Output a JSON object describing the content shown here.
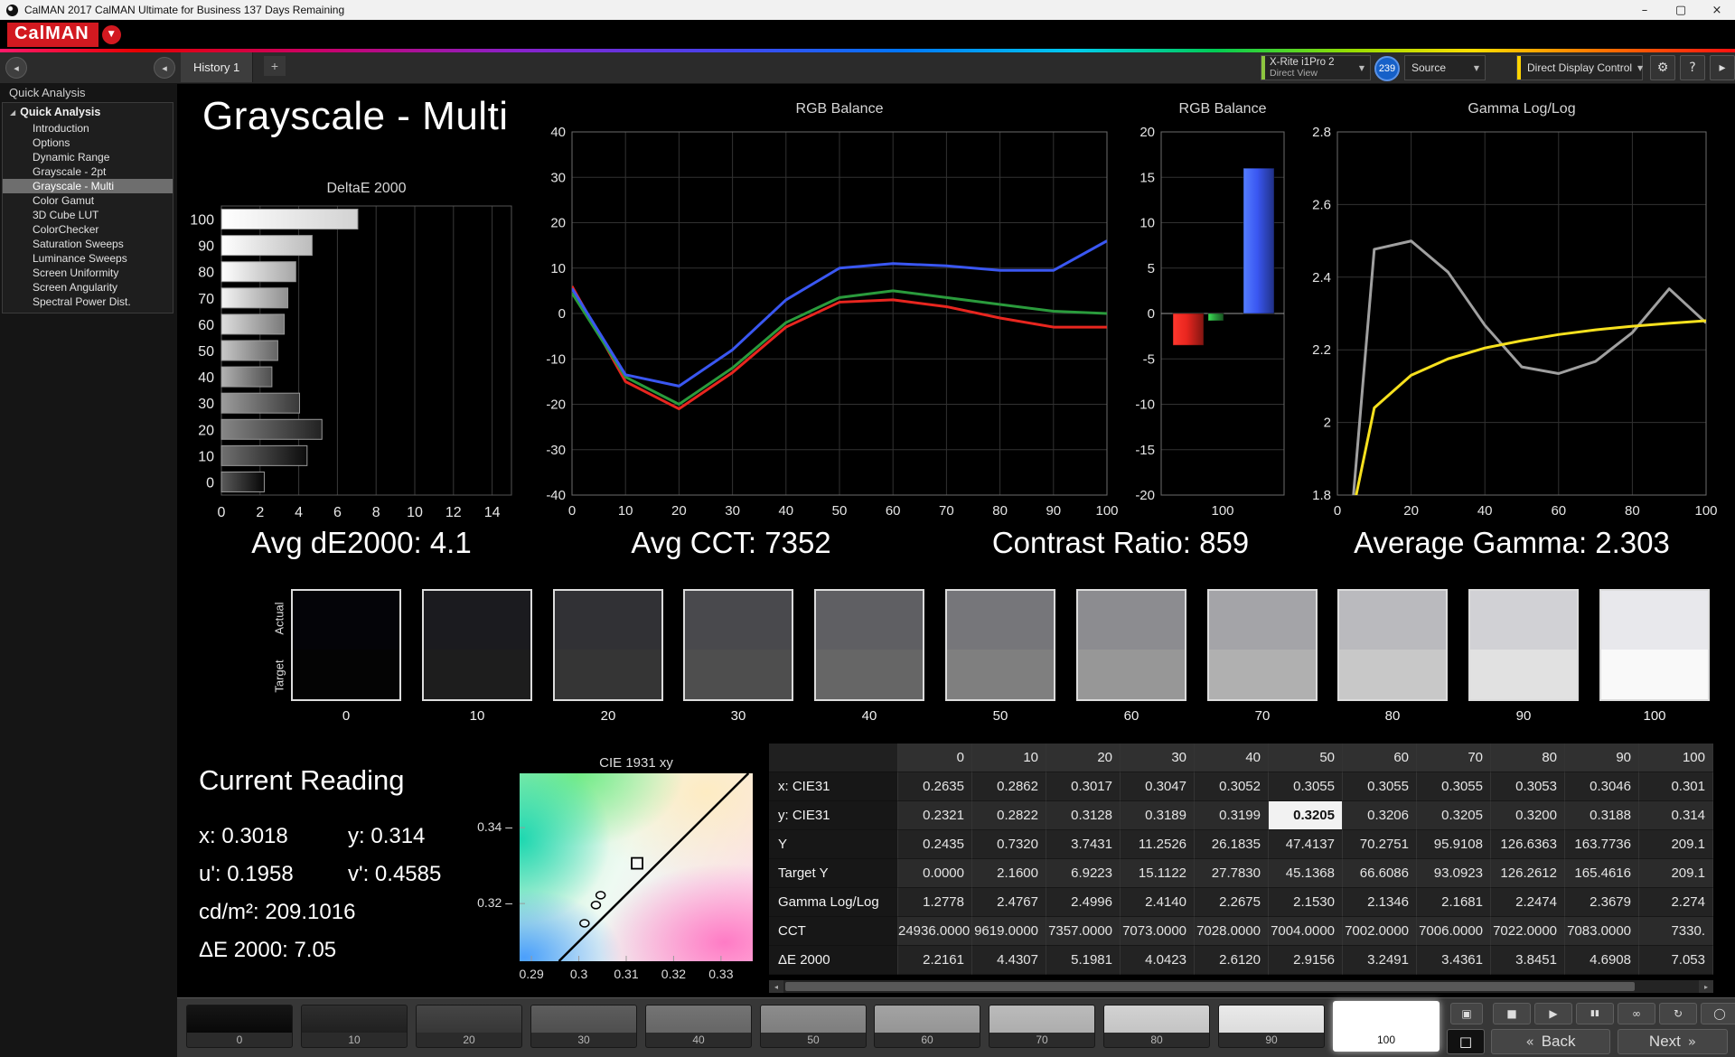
{
  "window": {
    "title": "CalMAN 2017 CalMAN Ultimate for Business 137 Days Remaining",
    "controls": [
      {
        "name": "minimize-button",
        "glyph": "–"
      },
      {
        "name": "maximize-button",
        "glyph": "▢"
      },
      {
        "name": "close-button",
        "glyph": "×"
      }
    ]
  },
  "brand": {
    "logo_text": "CalMAN",
    "dropdown_glyph": "▼",
    "accent": "#d21920"
  },
  "tabs": {
    "active": "History 1",
    "add_glyph": "+"
  },
  "toolbar": {
    "collapse_glyph": "◂",
    "chev_glyph": "▼",
    "meter": {
      "line1": "X-Rite i1Pro 2",
      "line2": "Direct View",
      "stripe": "#8dc63f"
    },
    "badge": "239",
    "source": {
      "label": "Source"
    },
    "display_control": {
      "label": "Direct Display Control",
      "stripe": "#ffd400"
    },
    "buttons": [
      {
        "name": "settings-button",
        "glyph": "⚙"
      },
      {
        "name": "help-button",
        "glyph": "?"
      },
      {
        "name": "advance-button",
        "glyph": "▸"
      }
    ]
  },
  "sidebar": {
    "panel_title": "Quick Analysis",
    "root": "Quick Analysis",
    "items": [
      "Introduction",
      "Options",
      "Dynamic Range",
      "Grayscale - 2pt",
      "Grayscale - Multi",
      "Color Gamut",
      "3D Cube LUT",
      "ColorChecker",
      "Saturation Sweeps",
      "Luminance Sweeps",
      "Screen Uniformity",
      "Screen Angularity",
      "Spectral Power Dist."
    ],
    "selected": "Grayscale - Multi"
  },
  "page": {
    "title": "Grayscale - Multi"
  },
  "stats": [
    "Avg dE2000: 4.1",
    "Avg CCT: 7352",
    "Contrast Ratio: 859",
    "Average Gamma: 2.303"
  ],
  "chart_data": [
    {
      "type": "bar",
      "orientation": "horizontal",
      "title": "DeltaE 2000",
      "categories": [
        "100",
        "90",
        "80",
        "70",
        "60",
        "50",
        "40",
        "30",
        "20",
        "10",
        "0"
      ],
      "values": [
        7.053,
        4.6908,
        3.8451,
        3.4361,
        3.2491,
        2.9156,
        2.612,
        4.0423,
        5.1981,
        4.4307,
        2.2161
      ],
      "xlim": [
        0,
        15
      ],
      "xticks": [
        0,
        2,
        4,
        6,
        8,
        10,
        12,
        14
      ],
      "grid": true
    },
    {
      "type": "line",
      "title": "RGB Balance",
      "x": [
        0,
        10,
        20,
        30,
        40,
        50,
        60,
        70,
        80,
        90,
        100
      ],
      "ylim": [
        -40,
        40
      ],
      "yticks": [
        -40,
        -30,
        -20,
        -10,
        0,
        10,
        20,
        30,
        40
      ],
      "xticks": [
        0,
        10,
        20,
        30,
        40,
        50,
        60,
        70,
        80,
        90,
        100
      ],
      "grid": true,
      "series": [
        {
          "name": "red-balance",
          "color": "#e8261f",
          "values": [
            6,
            -15,
            -21,
            -13,
            -3,
            2.5,
            3,
            1.5,
            -1,
            -3,
            -3
          ]
        },
        {
          "name": "green-balance",
          "color": "#2a9b3c",
          "values": [
            4.5,
            -14,
            -20,
            -12,
            -2,
            3.5,
            5,
            3.5,
            2,
            0.5,
            0
          ]
        },
        {
          "name": "blue-balance",
          "color": "#3a57f2",
          "values": [
            5.5,
            -13.5,
            -16,
            -8,
            3,
            10,
            11,
            10.5,
            9.5,
            9.5,
            16
          ]
        }
      ]
    },
    {
      "type": "bar",
      "title": "RGB Balance",
      "categories": [
        "100"
      ],
      "ylim": [
        -20,
        20
      ],
      "yticks": [
        -20,
        -15,
        -10,
        -5,
        0,
        5,
        10,
        15,
        20
      ],
      "grid": true,
      "series": [
        {
          "name": "red-error",
          "color": "#e8261f",
          "values": [
            -3.5
          ]
        },
        {
          "name": "green-error",
          "color": "#2a9b3c",
          "values": [
            -0.8
          ]
        },
        {
          "name": "blue-error",
          "color": "#3a57f2",
          "values": [
            16
          ]
        }
      ]
    },
    {
      "type": "line",
      "title": "Gamma Log/Log",
      "x": [
        0,
        10,
        20,
        30,
        40,
        50,
        60,
        70,
        80,
        90,
        100
      ],
      "ylim": [
        1.8,
        2.8
      ],
      "yticks": [
        1.8,
        2,
        2.2,
        2.4,
        2.6,
        2.8
      ],
      "xticks": [
        0,
        20,
        40,
        60,
        80,
        100
      ],
      "grid": true,
      "series": [
        {
          "name": "measured-gamma",
          "color": "#a0a0a0",
          "values": [
            1.2778,
            2.4767,
            2.4996,
            2.414,
            2.2675,
            2.153,
            2.1346,
            2.1681,
            2.2474,
            2.3679,
            2.274
          ]
        },
        {
          "name": "target-gamma",
          "color": "#f7e11e",
          "values": [
            1.55,
            2.04,
            2.13,
            2.175,
            2.205,
            2.225,
            2.242,
            2.255,
            2.265,
            2.273,
            2.28
          ]
        }
      ]
    },
    {
      "type": "scatter",
      "title": "CIE 1931 xy",
      "xlim": [
        0.2875,
        0.3367
      ],
      "ylim": [
        0.3048,
        0.3543
      ],
      "xticks": [
        0.29,
        0.3,
        0.31,
        0.32,
        0.33
      ],
      "yticks": [
        0.34,
        0.32
      ],
      "line": [
        [
          0.2958,
          0.3048
        ],
        [
          0.3358,
          0.3543
        ]
      ],
      "points": [
        {
          "shape": "square",
          "x": 0.3123,
          "y": 0.3306
        },
        {
          "shape": "circle",
          "x": 0.3046,
          "y": 0.3222
        },
        {
          "shape": "circle",
          "x": 0.3036,
          "y": 0.3196
        },
        {
          "shape": "circle",
          "x": 0.3012,
          "y": 0.3148
        }
      ]
    }
  ],
  "swatches": {
    "row_labels": [
      "Actual",
      "Target"
    ],
    "levels": [
      0,
      10,
      20,
      30,
      40,
      50,
      60,
      70,
      80,
      90,
      100
    ]
  },
  "current_reading": {
    "title": "Current Reading",
    "x_label": "x:",
    "x_value": "0.3018",
    "y_label": "y:",
    "y_value": "0.314",
    "u_label": "u':",
    "u_value": "0.1958",
    "v_label": "v':",
    "v_value": "0.4585",
    "lum_label": "cd/m²:",
    "lum_value": "209.1016",
    "de_label": "ΔE 2000:",
    "de_value": "7.05"
  },
  "table": {
    "columns": [
      "",
      "0",
      "10",
      "20",
      "30",
      "40",
      "50",
      "60",
      "70",
      "80",
      "90",
      "100"
    ],
    "rows": [
      {
        "label": "x: CIE31",
        "values": [
          "0.2635",
          "0.2862",
          "0.3017",
          "0.3047",
          "0.3052",
          "0.3055",
          "0.3055",
          "0.3055",
          "0.3053",
          "0.3046",
          "0.301"
        ]
      },
      {
        "label": "y: CIE31",
        "highlight_col": 5,
        "values": [
          "0.2321",
          "0.2822",
          "0.3128",
          "0.3189",
          "0.3199",
          "0.3205",
          "0.3206",
          "0.3205",
          "0.3200",
          "0.3188",
          "0.314"
        ]
      },
      {
        "label": "Y",
        "values": [
          "0.2435",
          "0.7320",
          "3.7431",
          "11.2526",
          "26.1835",
          "47.4137",
          "70.2751",
          "95.9108",
          "126.6363",
          "163.7736",
          "209.1"
        ]
      },
      {
        "label": "Target Y",
        "values": [
          "0.0000",
          "2.1600",
          "6.9223",
          "15.1122",
          "27.7830",
          "45.1368",
          "66.6086",
          "93.0923",
          "126.2612",
          "165.4616",
          "209.1"
        ]
      },
      {
        "label": "Gamma Log/Log",
        "values": [
          "1.2778",
          "2.4767",
          "2.4996",
          "2.4140",
          "2.2675",
          "2.1530",
          "2.1346",
          "2.1681",
          "2.2474",
          "2.3679",
          "2.274"
        ]
      },
      {
        "label": "CCT",
        "values": [
          "24936.0000",
          "9619.0000",
          "7357.0000",
          "7073.0000",
          "7028.0000",
          "7004.0000",
          "7002.0000",
          "7006.0000",
          "7022.0000",
          "7083.0000",
          "7330."
        ]
      },
      {
        "label": "ΔE 2000",
        "values": [
          "2.2161",
          "4.4307",
          "5.1981",
          "4.0423",
          "2.6120",
          "2.9156",
          "3.2491",
          "3.4361",
          "3.8451",
          "4.6908",
          "7.053"
        ]
      }
    ]
  },
  "bottom": {
    "patch_levels": [
      0,
      10,
      20,
      30,
      40,
      50,
      60,
      70,
      80,
      90,
      100
    ],
    "selected_level": 100,
    "eject_glyph": "▣",
    "pattern_glyph": "□",
    "transport": [
      {
        "name": "stop-button",
        "glyph": "■"
      },
      {
        "name": "play-button",
        "glyph": "▶"
      },
      {
        "name": "pause-button",
        "glyph": "▮▮"
      },
      {
        "name": "loop-button",
        "glyph": "∞"
      },
      {
        "name": "refresh-button",
        "glyph": "↻"
      },
      {
        "name": "record-button",
        "glyph": "◯"
      }
    ],
    "back_glyph": "«",
    "back_label": "Back",
    "next_label": "Next",
    "next_glyph": "»",
    "scroll_left_glyph": "◂",
    "scroll_right_glyph": "▸"
  }
}
